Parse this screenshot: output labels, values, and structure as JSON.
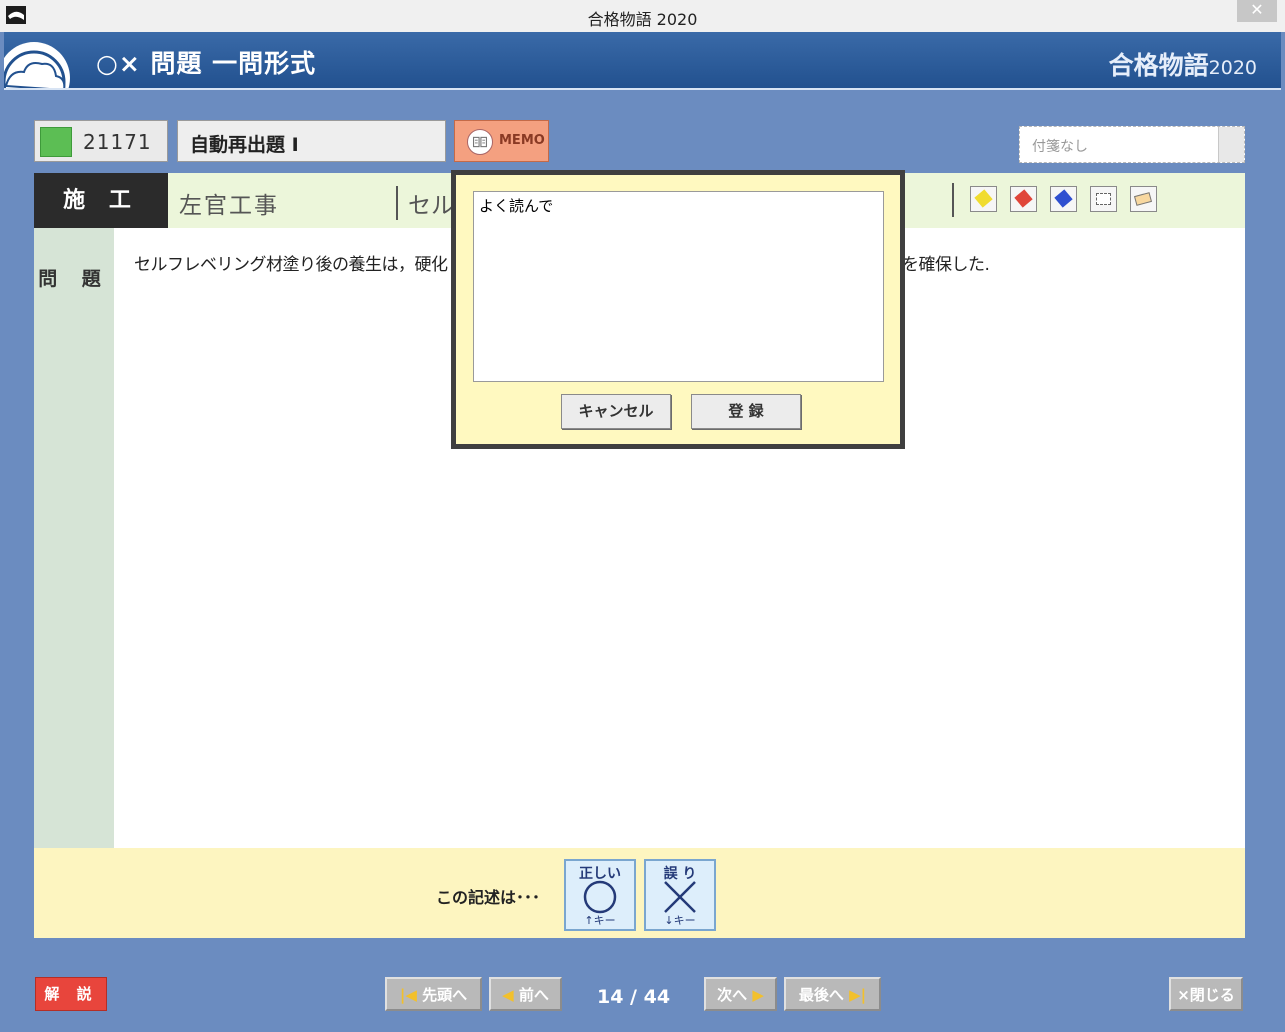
{
  "window": {
    "title": "合格物語 2020",
    "close_glyph": "✕"
  },
  "header": {
    "mode_title": "○× 問題 一問形式",
    "brand": "合格物語",
    "brand_year": "2020"
  },
  "toolbar": {
    "question_id": "21171",
    "status_color": "#5cbe54",
    "mode": "自動再出題 Ⅰ",
    "memo_label": "MEMO",
    "sticky_placeholder": "付箋なし"
  },
  "category": {
    "major": "施 工",
    "sub": "左官工事",
    "topic": "セル"
  },
  "tools": [
    "yellow-marker-icon",
    "red-marker-icon",
    "blue-marker-icon",
    "clear-screen-icon",
    "eraser-icon"
  ],
  "question": {
    "label": "問 題",
    "text_visible": "セルフレベリング材塗り後の養生は，硬化",
    "text_tail": "を確保した."
  },
  "answer": {
    "prompt": "この記述は･･･",
    "correct_label": "正しい",
    "correct_key": "↑キー",
    "wrong_label": "誤 り",
    "wrong_key": "↓キー"
  },
  "nav": {
    "explain": "解 説",
    "first": "先頭へ",
    "prev": "前へ",
    "next": "次へ",
    "last": "最後へ",
    "first_arrow": "|◀",
    "prev_arrow": "◀",
    "next_arrow": "▶",
    "last_arrow": "▶|",
    "page": "14 / 44",
    "close": "×閉じる"
  },
  "memo_dialog": {
    "text": "よく読んで",
    "cancel": "キャンセル",
    "register": "登 録"
  }
}
